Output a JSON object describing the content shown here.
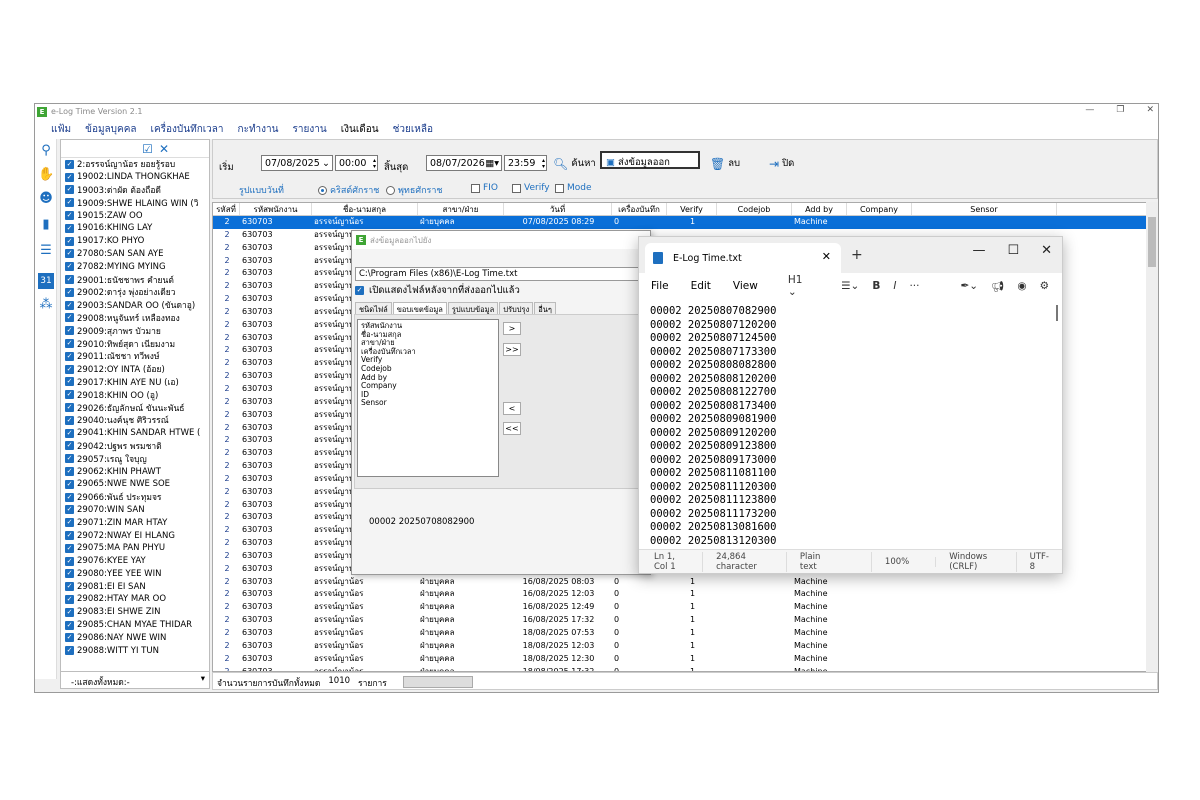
{
  "app": {
    "title": "e-Log Time Version 2.1",
    "icon_letter": "E"
  },
  "menu": [
    "แฟ้ม",
    "ข้อมูลบุคคล",
    "เครื่องบันทึกเวลา",
    "กะทำงาน",
    "รายงาน",
    "เงินเดือน",
    "ช่วยเหลือ"
  ],
  "toolbar": {
    "start_label": "เริ่ม",
    "start_date": "07/08/2025",
    "start_time": "00:00",
    "end_label": "สิ้นสุด",
    "end_date": "08/07/2026",
    "end_time": "23:59",
    "search": "ค้นหา",
    "export": "ส่งข้อมูลออก",
    "delete": "ลบ",
    "close": "ปิด",
    "date_format_label": "รูปแบบวันที่",
    "opt_christian": "คริสต์ศักราช",
    "opt_buddhist": "พุทธศักราช",
    "opt_fio": "FIO",
    "opt_verify": "Verify",
    "opt_mode": "Mode"
  },
  "employees": [
    "2:อรรจน์ญาน้อร ยอยรู้รอบ",
    "19002:LINDA THONGKHAE",
    "19003:ด่าผัด ต้องถือดี",
    "19009:SHWE HLAING WIN (วิ",
    "19015:ZAW OO",
    "19016:KHING LAY",
    "19017:KO PHYO",
    "27080:SAN SAN AYE",
    "27082:MYING MYING",
    "29001:ธนัชชาพร คำยนต์",
    "29002:ดารุ่ง พุ่งอย่างเดียว",
    "29003:SANDAR OO (ขันดาอู)",
    "29008:หนูจันทร์ เหลืองทอง",
    "29009:สุภาพร บัวมาย",
    "29010:ทิพย์สุดา เนียมงาม",
    "29011:ณัชชา ทวีพงษ์",
    "29012:OY INTA (อ้อย)",
    "29017:KHIN AYE NU (เอ)",
    "29018:KHIN OO (อู)",
    "29026:ธัญลักษณ์ ขันนะพันธ์",
    "29040:นงค์นุช ศิริวรรณ์",
    "29041:KHIN SANDAR HTWE (",
    "29042:ปฐพร พรมชาติ",
    "29057:เรณู ใจบุญ",
    "29062:KHIN PHAWT",
    "29065:NWE NWE SOE",
    "29066:พันธ์ ประทุมจร",
    "29070:WIN SAN",
    "29071:ZIN MAR HTAY",
    "29072:NWAY EI HLANG",
    "29075:MA PAN PHYU",
    "29076:KYEE YAY",
    "29080:YEE YEE WIN",
    "29081:EI EI SAN",
    "29082:HTAY MAR OO",
    "29083:EI SHWE ZIN",
    "29085:CHAN MYAE THIDAR",
    "29086:NAY NWE WIN",
    "29088:WITT YI TUN"
  ],
  "filter": "-:แสดงทั้งหมด:-",
  "grid": {
    "headers": [
      "รหัสที่",
      "รหัสพนักงาน",
      "ชื่อ-นามสกุล",
      "สาขา/ฝ่าย",
      "วันที่",
      "เครื่องบันทึก",
      "Verify",
      "Codejob",
      "Add by",
      "Company",
      "Sensor"
    ],
    "first_row": [
      "2",
      "630703",
      "อรรจน์ญาน้อร",
      "ฝ่ายบุคคล",
      "07/08/2025 08:29",
      "0",
      "1",
      "",
      "Machine",
      "",
      ""
    ],
    "rows": [
      [
        "2",
        "630703",
        "อรรจน์ญาน้อร",
        "",
        "",
        "",
        "",
        "",
        "",
        "",
        ""
      ],
      [
        "2",
        "630703",
        "อรรจน์ญาน้อร",
        "",
        "",
        "",
        "",
        "",
        "",
        "",
        ""
      ],
      [
        "2",
        "630703",
        "อรรจน์ญาน้อร",
        "",
        "",
        "",
        "",
        "",
        "",
        "",
        ""
      ],
      [
        "2",
        "630703",
        "อรรจน์ญาน้อร",
        "",
        "",
        "",
        "",
        "",
        "",
        "",
        ""
      ],
      [
        "2",
        "630703",
        "อรรจน์ญาน้อร",
        "",
        "",
        "",
        "",
        "",
        "",
        "",
        ""
      ],
      [
        "2",
        "630703",
        "อรรจน์ญาน้อร",
        "",
        "",
        "",
        "",
        "",
        "",
        "",
        ""
      ],
      [
        "2",
        "630703",
        "อรรจน์ญาน้อร",
        "",
        "",
        "",
        "",
        "",
        "",
        "",
        ""
      ],
      [
        "2",
        "630703",
        "อรรจน์ญาน้อร",
        "",
        "",
        "",
        "",
        "",
        "",
        "",
        ""
      ],
      [
        "2",
        "630703",
        "อรรจน์ญาน้อร",
        "",
        "",
        "",
        "",
        "",
        "",
        "",
        ""
      ],
      [
        "2",
        "630703",
        "อรรจน์ญาน้อร",
        "",
        "",
        "",
        "",
        "",
        "",
        "",
        ""
      ],
      [
        "2",
        "630703",
        "อรรจน์ญาน้อร",
        "",
        "",
        "",
        "",
        "",
        "",
        "",
        ""
      ],
      [
        "2",
        "630703",
        "อรรจน์ญาน้อร",
        "",
        "",
        "",
        "",
        "",
        "",
        "",
        ""
      ],
      [
        "2",
        "630703",
        "อรรจน์ญาน้อร",
        "",
        "",
        "",
        "",
        "",
        "",
        "",
        ""
      ],
      [
        "2",
        "630703",
        "อรรจน์ญาน้อร",
        "",
        "",
        "",
        "",
        "",
        "",
        "",
        ""
      ],
      [
        "2",
        "630703",
        "อรรจน์ญาน้อร",
        "",
        "",
        "",
        "",
        "",
        "",
        "",
        ""
      ],
      [
        "2",
        "630703",
        "อรรจน์ญาน้อร",
        "",
        "",
        "",
        "",
        "",
        "",
        "",
        ""
      ],
      [
        "2",
        "630703",
        "อรรจน์ญาน้อร",
        "",
        "",
        "",
        "",
        "",
        "",
        "",
        ""
      ],
      [
        "2",
        "630703",
        "อรรจน์ญาน้อร",
        "",
        "",
        "",
        "",
        "",
        "",
        "",
        ""
      ],
      [
        "2",
        "630703",
        "อรรจน์ญาน้อร",
        "",
        "",
        "",
        "",
        "",
        "",
        "",
        ""
      ],
      [
        "2",
        "630703",
        "อรรจน์ญาน้อร",
        "",
        "",
        "",
        "",
        "",
        "",
        "",
        ""
      ],
      [
        "2",
        "630703",
        "อรรจน์ญาน้อร",
        "",
        "",
        "",
        "",
        "",
        "",
        "",
        ""
      ],
      [
        "2",
        "630703",
        "อรรจน์ญาน้อร",
        "",
        "",
        "",
        "",
        "",
        "",
        "",
        ""
      ],
      [
        "2",
        "630703",
        "อรรจน์ญาน้อร",
        "",
        "",
        "",
        "",
        "",
        "",
        "",
        ""
      ],
      [
        "2",
        "630703",
        "อรรจน์ญาน้อร",
        "",
        "",
        "",
        "",
        "",
        "",
        "",
        ""
      ],
      [
        "2",
        "630703",
        "อรรจน์ญาน้อร",
        "",
        "",
        "",
        "",
        "",
        "",
        "",
        ""
      ],
      [
        "2",
        "630703",
        "อรรจน์ญาน้อร",
        "",
        "",
        "",
        "",
        "",
        "",
        "",
        ""
      ],
      [
        "2",
        "630703",
        "อรรจน์ญาน้อร",
        "",
        "",
        "",
        "",
        "",
        "",
        "",
        ""
      ],
      [
        "2",
        "630703",
        "อรรจน์ญาน้อร",
        "ฝ่ายบุคคล",
        "16/08/2025 08:03",
        "0",
        "1",
        "",
        "Machine",
        "",
        ""
      ],
      [
        "2",
        "630703",
        "อรรจน์ญาน้อร",
        "ฝ่ายบุคคล",
        "16/08/2025 12:03",
        "0",
        "1",
        "",
        "Machine",
        "",
        ""
      ],
      [
        "2",
        "630703",
        "อรรจน์ญาน้อร",
        "ฝ่ายบุคคล",
        "16/08/2025 12:49",
        "0",
        "1",
        "",
        "Machine",
        "",
        ""
      ],
      [
        "2",
        "630703",
        "อรรจน์ญาน้อร",
        "ฝ่ายบุคคล",
        "16/08/2025 17:32",
        "0",
        "1",
        "",
        "Machine",
        "",
        ""
      ],
      [
        "2",
        "630703",
        "อรรจน์ญาน้อร",
        "ฝ่ายบุคคล",
        "18/08/2025 07:53",
        "0",
        "1",
        "",
        "Machine",
        "",
        ""
      ],
      [
        "2",
        "630703",
        "อรรจน์ญาน้อร",
        "ฝ่ายบุคคล",
        "18/08/2025 12:03",
        "0",
        "1",
        "",
        "Machine",
        "",
        ""
      ],
      [
        "2",
        "630703",
        "อรรจน์ญาน้อร",
        "ฝ่ายบุคคล",
        "18/08/2025 12:30",
        "0",
        "1",
        "",
        "Machine",
        "",
        ""
      ],
      [
        "2",
        "630703",
        "อรรจน์ญาน้อร",
        "ฝ่ายบุคคล",
        "18/08/2025 17:32",
        "0",
        "1",
        "",
        "Machine",
        "",
        ""
      ],
      [
        "2",
        "630703",
        "อรรจน์ญาน้อร",
        "ฝ่ายบุคคล",
        "18/08/2025 17:32",
        "0",
        "1",
        "",
        "Machine",
        "",
        ""
      ]
    ]
  },
  "status": {
    "label": "จำนวนรายการบันทึกทั้งหมด",
    "count": "1010",
    "unit": "รายการ"
  },
  "dialog": {
    "title": "ส่งข้อมูลออกไปยัง",
    "path": "C:\\Program Files (x86)\\E-Log Time.txt",
    "open_after": "เปิดแสดงไฟล์หลังจากที่ส่งออกไปแล้ว",
    "tabs": [
      "ชนิดไฟล์",
      "ขอบเขตข้อมูล",
      "รูปแบบข้อมูล",
      "ปรับปรุง",
      "อื่นๆ"
    ],
    "fields": [
      "รหัสพนักงาน",
      "ชื่อ-นามสกุล",
      "สาขา/ฝ่าย",
      "เครื่องบันทึกเวลา",
      "Verify",
      "Codejob",
      "Add by",
      "Company",
      "ID",
      "Sensor"
    ],
    "btn_add": ">",
    "btn_add_all": ">>",
    "btn_remove": "<",
    "btn_remove_all": "<<",
    "preview": "00002 20250708082900"
  },
  "notepad": {
    "tab_title": "E-Log Time.txt",
    "menu": [
      "File",
      "Edit",
      "View"
    ],
    "heading": "H1",
    "bold": "B",
    "italic": "I",
    "more": "···",
    "content": "00002 20250807082900\n00002 20250807120200\n00002 20250807124500\n00002 20250807173300\n00002 20250808082800\n00002 20250808120200\n00002 20250808122700\n00002 20250808173400\n00002 20250809081900\n00002 20250809120200\n00002 20250809123800\n00002 20250809173000\n00002 20250811081100\n00002 20250811120300\n00002 20250811123800\n00002 20250811173200\n00002 20250813081600\n00002 20250813120300",
    "status": {
      "pos": "Ln 1, Col 1",
      "chars": "24,864 character",
      "mode": "Plain text",
      "zoom": "100%",
      "eol": "Windows (CRLF)",
      "enc": "UTF-8"
    }
  }
}
